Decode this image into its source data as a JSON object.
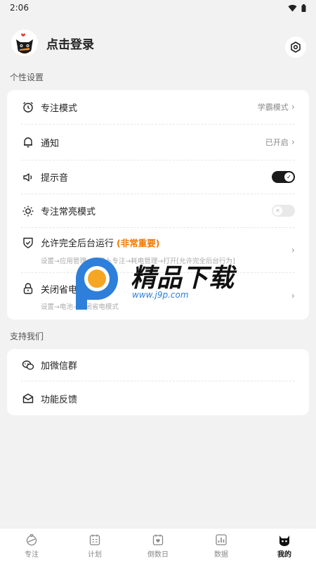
{
  "status_bar": {
    "time": "2:06"
  },
  "header": {
    "login_text": "点击登录"
  },
  "personal_settings": {
    "title": "个性设置",
    "focus_mode": {
      "label": "专注模式",
      "value": "学霸模式"
    },
    "notification": {
      "label": "通知",
      "value": "已开启"
    },
    "sound": {
      "label": "提示音",
      "enabled": true
    },
    "screen_on": {
      "label": "专注常亮模式",
      "enabled": false
    },
    "background_run": {
      "label": "允许完全后台运行",
      "important": "(非常重要)",
      "subtitle": "设置→应用管理→胡萝卜专注→耗电管理→打开[允许完全后台行为]"
    },
    "power_saving": {
      "label": "关闭省电模式",
      "subtitle": "设置→电池→关闭省电模式"
    }
  },
  "support": {
    "title": "支持我们",
    "wechat_group": {
      "label": "加微信群"
    },
    "feedback": {
      "label": "功能反馈"
    }
  },
  "tabbar": {
    "tabs": [
      {
        "label": "专注",
        "icon": "focus-icon"
      },
      {
        "label": "计划",
        "icon": "plan-icon"
      },
      {
        "label": "倒数日",
        "icon": "countdown-icon"
      },
      {
        "label": "数据",
        "icon": "data-icon"
      },
      {
        "label": "我的",
        "icon": "cat-icon",
        "active": true
      }
    ]
  },
  "watermark": {
    "text": "精品下载",
    "url": "www.j9p.com"
  },
  "colors": {
    "accent_orange": "#f07800",
    "toggle_on": "#1a1a1a",
    "background": "#f2f2f2"
  }
}
